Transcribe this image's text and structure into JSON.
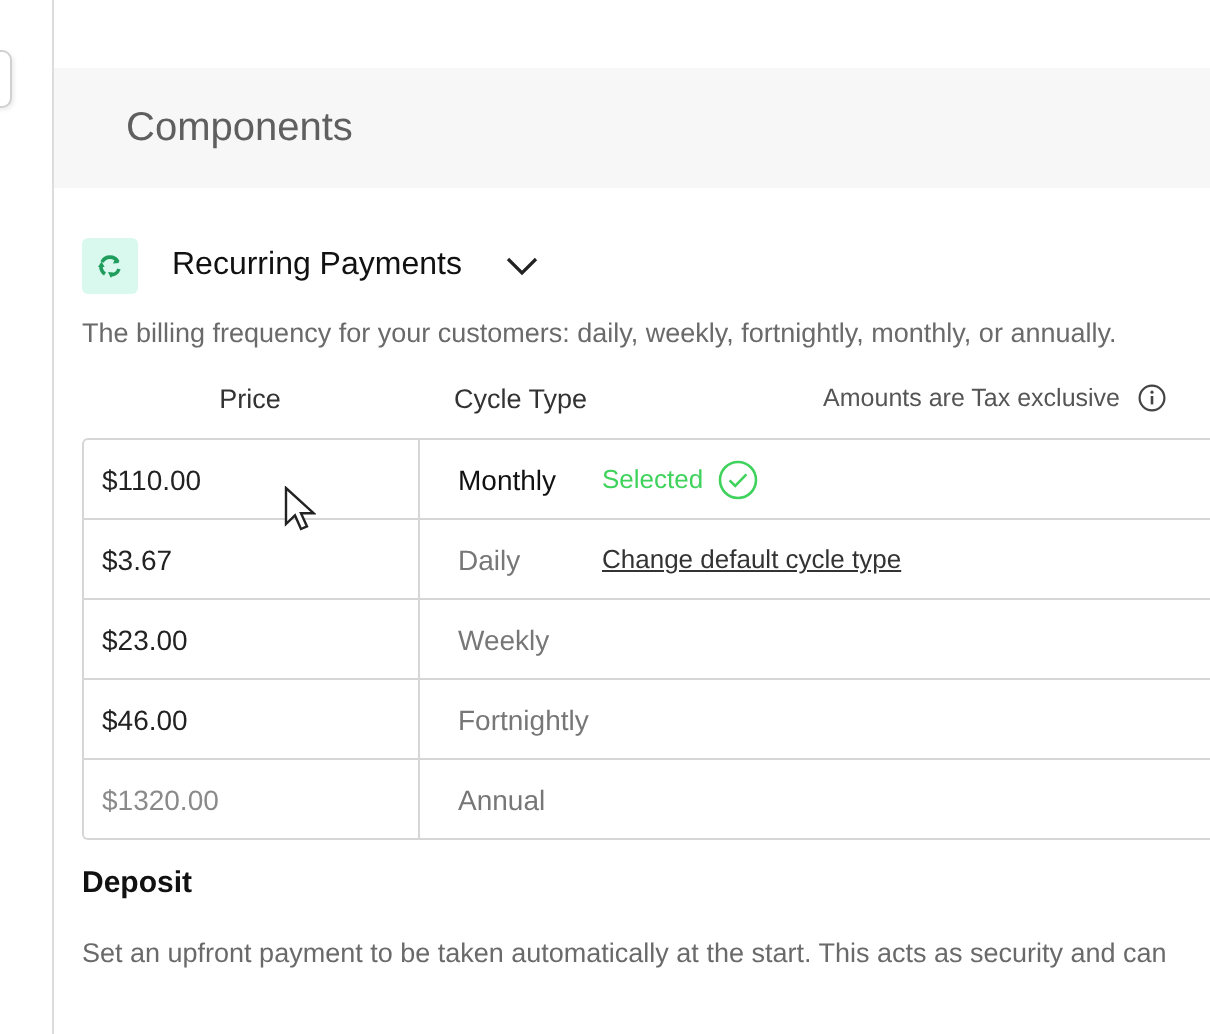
{
  "header": {
    "title": "Components"
  },
  "recurring": {
    "title": "Recurring Payments",
    "expanded": true,
    "description": "The billing frequency for your customers: daily, weekly, fortnightly, monthly, or annually.",
    "columns": [
      "Price",
      "Cycle Type"
    ],
    "tax_note": "Amounts are Tax exclusive",
    "rows": [
      {
        "price": "$110.00",
        "cycle": "Monthly",
        "selected": true,
        "status": "Selected"
      },
      {
        "price": "$3.67",
        "cycle": "Daily",
        "selected": false,
        "link": "Change default cycle type"
      },
      {
        "price": "$23.00",
        "cycle": "Weekly",
        "selected": false
      },
      {
        "price": "$46.00",
        "cycle": "Fortnightly",
        "selected": false
      },
      {
        "placeholder": "$1320.00",
        "cycle": "Annual",
        "selected": false
      }
    ]
  },
  "deposit": {
    "title": "Deposit",
    "description": "Set an upfront payment to be taken automatically at the start. This acts as security and can"
  }
}
